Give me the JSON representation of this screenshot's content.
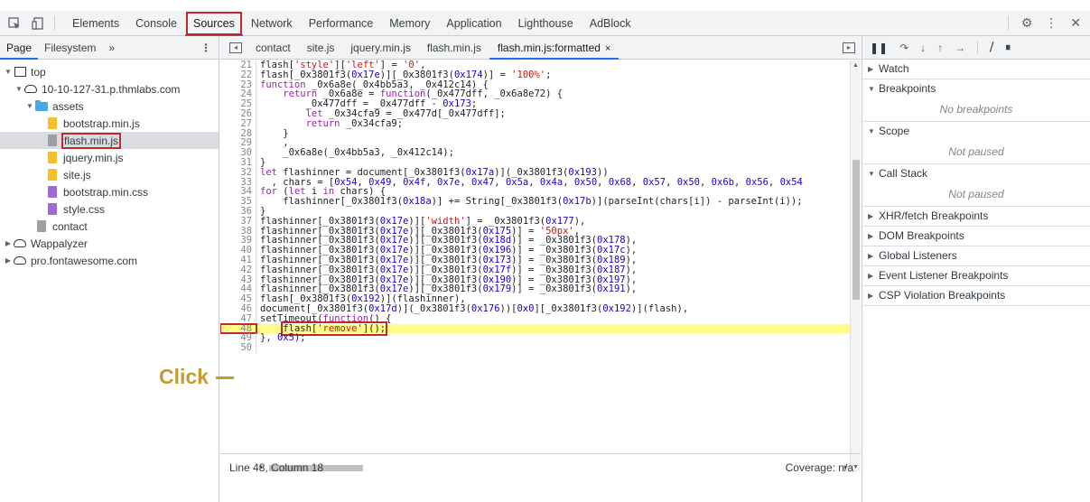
{
  "toolbar": {
    "tabs": [
      "Elements",
      "Console",
      "Sources",
      "Network",
      "Performance",
      "Memory",
      "Application",
      "Lighthouse",
      "AdBlock"
    ],
    "active_tab": "Sources"
  },
  "navigator": {
    "tabs": [
      "Page",
      "Filesystem",
      "»"
    ],
    "tree": [
      {
        "label": "top",
        "arrow": "▼",
        "icon": "frame",
        "indent": 0
      },
      {
        "label": "10-10-127-31.p.thmlabs.com",
        "arrow": "▼",
        "icon": "cloud",
        "indent": 1
      },
      {
        "label": "assets",
        "arrow": "▼",
        "icon": "folder",
        "indent": 2
      },
      {
        "label": "bootstrap.min.js",
        "arrow": "",
        "icon": "js",
        "indent": 3
      },
      {
        "label": "flash.min.js",
        "arrow": "",
        "icon": "doc",
        "indent": 3,
        "selected": true
      },
      {
        "label": "jquery.min.js",
        "arrow": "",
        "icon": "js",
        "indent": 3
      },
      {
        "label": "site.js",
        "arrow": "",
        "icon": "js",
        "indent": 3
      },
      {
        "label": "bootstrap.min.css",
        "arrow": "",
        "icon": "css",
        "indent": 3
      },
      {
        "label": "style.css",
        "arrow": "",
        "icon": "css",
        "indent": 3
      },
      {
        "label": "contact",
        "arrow": "",
        "icon": "doc",
        "indent": 2
      },
      {
        "label": "Wappalyzer",
        "arrow": "▶",
        "icon": "cloud",
        "indent": 0
      },
      {
        "label": "pro.fontawesome.com",
        "arrow": "▶",
        "icon": "cloud",
        "indent": 0
      }
    ]
  },
  "editor": {
    "tabs": [
      "contact",
      "site.js",
      "jquery.min.js",
      "flash.min.js",
      "flash.min.js:formatted"
    ],
    "active_tab": "flash.min.js:formatted",
    "close_glyph": "×",
    "highlight_line": 48,
    "lines": [
      {
        "n": "21",
        "t": "flash['style']['left'] = '0',"
      },
      {
        "n": "22",
        "t": "flash[_0x3801f3(0x17e)][_0x3801f3(0x174)] = '100%';"
      },
      {
        "n": "23",
        "t": "function _0x6a8e(_0x4bb5a3, _0x412c14) {"
      },
      {
        "n": "24",
        "t": "    return _0x6a8e = function(_0x477dff, _0x6a8e72) {"
      },
      {
        "n": "25",
        "t": "        _0x477dff = _0x477dff - 0x173;"
      },
      {
        "n": "26",
        "t": "        let _0x34cfa9 = _0x477d[_0x477dff];"
      },
      {
        "n": "27",
        "t": "        return _0x34cfa9;"
      },
      {
        "n": "28",
        "t": "    }"
      },
      {
        "n": "29",
        "t": "    ,"
      },
      {
        "n": "30",
        "t": "    _0x6a8e(_0x4bb5a3, _0x412c14);"
      },
      {
        "n": "31",
        "t": "}"
      },
      {
        "n": "32",
        "t": "let flashinner = document[_0x3801f3(0x17a)](_0x3801f3(0x193))"
      },
      {
        "n": "33",
        "t": "  , chars = [0x54, 0x49, 0x4f, 0x7e, 0x47, 0x5a, 0x4a, 0x50, 0x68, 0x57, 0x50, 0x6b, 0x56, 0x54"
      },
      {
        "n": "34",
        "t": "for (let i in chars) {"
      },
      {
        "n": "35",
        "t": "    flashinner[_0x3801f3(0x18a)] += String[_0x3801f3(0x17b)](parseInt(chars[i]) - parseInt(i));"
      },
      {
        "n": "36",
        "t": "}"
      },
      {
        "n": "37",
        "t": "flashinner[_0x3801f3(0x17e)]['width'] = _0x3801f3(0x177),"
      },
      {
        "n": "38",
        "t": "flashinner[_0x3801f3(0x17e)][_0x3801f3(0x175)] = '50px',"
      },
      {
        "n": "39",
        "t": "flashinner[_0x3801f3(0x17e)][_0x3801f3(0x18d)] = _0x3801f3(0x178),"
      },
      {
        "n": "40",
        "t": "flashinner[_0x3801f3(0x17e)][_0x3801f3(0x196)] = _0x3801f3(0x17c),"
      },
      {
        "n": "41",
        "t": "flashinner[_0x3801f3(0x17e)][_0x3801f3(0x173)] = _0x3801f3(0x189),"
      },
      {
        "n": "42",
        "t": "flashinner[_0x3801f3(0x17e)][_0x3801f3(0x17f)] = _0x3801f3(0x187),"
      },
      {
        "n": "43",
        "t": "flashinner[_0x3801f3(0x17e)][_0x3801f3(0x190)] = _0x3801f3(0x197),"
      },
      {
        "n": "44",
        "t": "flashinner[_0x3801f3(0x17e)][_0x3801f3(0x179)] = _0x3801f3(0x191),"
      },
      {
        "n": "45",
        "t": "flash[_0x3801f3(0x192)](flashinner),"
      },
      {
        "n": "46",
        "t": "document[_0x3801f3(0x17d)](_0x3801f3(0x176))[0x0][_0x3801f3(0x192)](flash),"
      },
      {
        "n": "47",
        "t": "setTimeout(function() {"
      },
      {
        "n": "48",
        "t": "    flash['remove']();"
      },
      {
        "n": "49",
        "t": "}, 0x5);"
      },
      {
        "n": "50",
        "t": ""
      }
    ]
  },
  "status": {
    "position": "Line 48, Column 18",
    "coverage": "Coverage: n/a"
  },
  "debugger": {
    "sections": [
      {
        "title": "Watch",
        "arrow": "▶",
        "body": ""
      },
      {
        "title": "Breakpoints",
        "arrow": "▼",
        "body": "No breakpoints"
      },
      {
        "title": "Scope",
        "arrow": "▼",
        "body": "Not paused"
      },
      {
        "title": "Call Stack",
        "arrow": "▼",
        "body": "Not paused"
      },
      {
        "title": "XHR/fetch Breakpoints",
        "arrow": "▶",
        "body": ""
      },
      {
        "title": "DOM Breakpoints",
        "arrow": "▶",
        "body": ""
      },
      {
        "title": "Global Listeners",
        "arrow": "▶",
        "body": ""
      },
      {
        "title": "Event Listener Breakpoints",
        "arrow": "▶",
        "body": ""
      },
      {
        "title": "CSP Violation Breakpoints",
        "arrow": "▶",
        "body": ""
      }
    ]
  },
  "annotation": {
    "label": "Click"
  },
  "colors": {
    "accent": "#1a73e8",
    "highlight_box": "#c0282d",
    "annotation": "#c69a2e",
    "line_highlight": "#fffb85"
  }
}
